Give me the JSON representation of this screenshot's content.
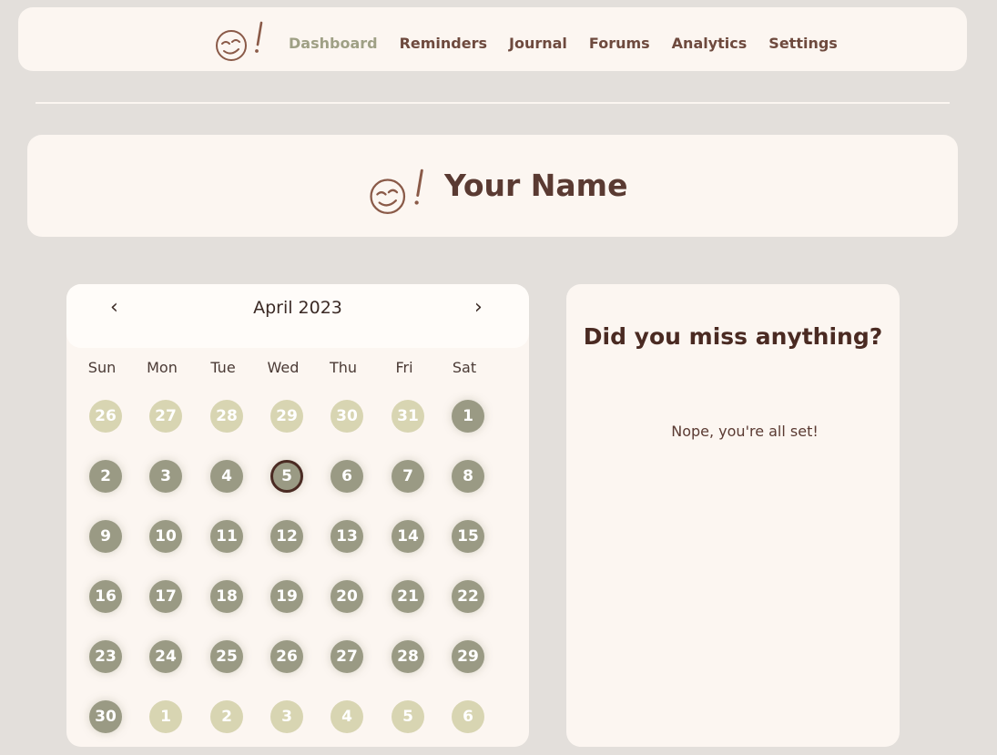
{
  "nav": {
    "logo": "smiley-logo-icon",
    "links": [
      "Dashboard",
      "Reminders",
      "Journal",
      "Forums",
      "Analytics",
      "Settings"
    ],
    "active": "Dashboard"
  },
  "profile": {
    "logo": "smiley-logo-icon",
    "name": "Your Name"
  },
  "calendar": {
    "title": "April 2023",
    "prev_icon": "chevron-left-icon",
    "next_icon": "chevron-right-icon",
    "prev_label": "‹",
    "next_label": "›",
    "weekdays": [
      "Sun",
      "Mon",
      "Tue",
      "Wed",
      "Thu",
      "Fri",
      "Sat"
    ],
    "weeks": [
      [
        "26",
        "27",
        "28",
        "29",
        "30",
        "31",
        "1"
      ],
      [
        "2",
        "3",
        "4",
        "5",
        "6",
        "7",
        "8"
      ],
      [
        "9",
        "10",
        "11",
        "12",
        "13",
        "14",
        "15"
      ],
      [
        "16",
        "17",
        "18",
        "19",
        "20",
        "21",
        "22"
      ],
      [
        "23",
        "24",
        "25",
        "26",
        "27",
        "28",
        "29"
      ],
      [
        "30",
        "1",
        "2",
        "3",
        "4",
        "5",
        "6"
      ]
    ],
    "today": "5"
  },
  "reminders_panel": {
    "title": "Did you miss anything?",
    "message": "Nope, you're all set!"
  },
  "colors": {
    "background": "#e3dfdb",
    "card": "#fcf6f1",
    "accent": "#9fa085",
    "day_current": "#9a9a84",
    "day_other": "#d8d5b2",
    "text_dark": "#4a2a22"
  }
}
